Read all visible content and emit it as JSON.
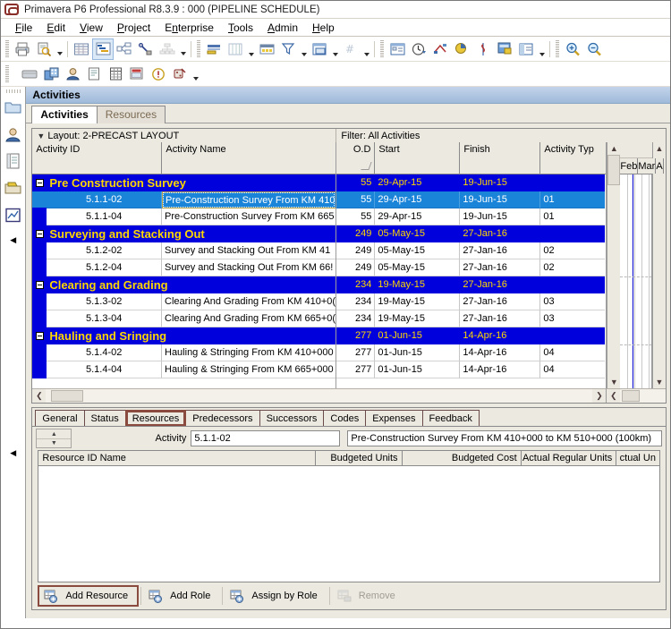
{
  "window": {
    "title": "Primavera P6 Professional R8.3.9 : 000 (PIPELINE SCHEDULE)",
    "logo_icon": "primavera-logo-icon"
  },
  "menubar": {
    "items": [
      {
        "label": "File",
        "accel": "F"
      },
      {
        "label": "Edit",
        "accel": "E"
      },
      {
        "label": "View",
        "accel": "V"
      },
      {
        "label": "Project",
        "accel": "P"
      },
      {
        "label": "Enterprise",
        "accel": "n"
      },
      {
        "label": "Tools",
        "accel": "T"
      },
      {
        "label": "Admin",
        "accel": "A"
      },
      {
        "label": "Help",
        "accel": "H"
      }
    ]
  },
  "toolbar_row1": {
    "buttons": [
      {
        "name": "print-icon"
      },
      {
        "name": "print-preview-icon"
      },
      {
        "name": "caret-down-icon"
      },
      {
        "name": "activity-table-icon"
      },
      {
        "name": "gantt-chart-icon"
      },
      {
        "name": "activity-network-icon"
      },
      {
        "name": "trace-logic-icon"
      },
      {
        "name": "wbs-chart-icon"
      },
      {
        "name": "caret-down-icon"
      },
      {
        "name": "bars-icon"
      },
      {
        "name": "columns-icon"
      },
      {
        "name": "caret-down-icon"
      },
      {
        "name": "timescale-icon"
      },
      {
        "name": "filter-icon"
      },
      {
        "name": "caret-down-icon"
      },
      {
        "name": "group-and-sort-icon"
      },
      {
        "name": "caret-down-icon"
      },
      {
        "name": "page-number-icon"
      },
      {
        "name": "caret-down-icon"
      },
      {
        "name": "activity-details-icon"
      },
      {
        "name": "progress-spotlight-icon"
      },
      {
        "name": "schedule-icon"
      },
      {
        "name": "level-resources-icon"
      },
      {
        "name": "progress-line-icon"
      },
      {
        "name": "store-period-performance-icon"
      },
      {
        "name": "layout-icon"
      },
      {
        "name": "caret-down-icon"
      },
      {
        "name": "zoom-in-icon"
      },
      {
        "name": "zoom-out-icon"
      }
    ]
  },
  "toolbar_row2": {
    "buttons": [
      {
        "name": "projects-icon"
      },
      {
        "name": "wbs-icon"
      },
      {
        "name": "resources-icon"
      },
      {
        "name": "reports-icon"
      },
      {
        "name": "activities-table-icon"
      },
      {
        "name": "assignments-icon"
      },
      {
        "name": "issues-icon"
      },
      {
        "name": "risks-icon"
      },
      {
        "name": "caret-down-icon"
      }
    ]
  },
  "left_rail": {
    "buttons": [
      {
        "name": "projects-rail-icon"
      },
      {
        "name": "resources-rail-icon"
      },
      {
        "name": "reports-rail-icon"
      },
      {
        "name": "wbs-rail-icon"
      },
      {
        "name": "tracking-rail-icon"
      }
    ],
    "collapse_icon": "collapse-left-icon"
  },
  "window_header": {
    "title": "Activities"
  },
  "main_tabs": [
    {
      "label": "Activities",
      "active": true
    },
    {
      "label": "Resources",
      "active": false
    }
  ],
  "activities_panel": {
    "layout_label": "Layout: 2-PRECAST LAYOUT",
    "filter_label": "Filter: All Activities",
    "columns": [
      {
        "key": "id",
        "label": "Activity ID"
      },
      {
        "key": "name",
        "label": "Activity Name"
      },
      {
        "key": "od",
        "label": "O.D",
        "align": "right",
        "sorted": true
      },
      {
        "key": "start",
        "label": "Start"
      },
      {
        "key": "finish",
        "label": "Finish"
      },
      {
        "key": "type",
        "label": "Activity Typ"
      }
    ],
    "rows": [
      {
        "kind": "summary",
        "id": "Pre Construction Survey",
        "name": "",
        "od": "55",
        "start": "29-Apr-15",
        "finish": "19-Jun-15",
        "type": ""
      },
      {
        "kind": "selected",
        "id": "5.1.1-02",
        "name": "Pre-Construction Survey From KM 410",
        "od": "55",
        "start": "29-Apr-15",
        "finish": "19-Jun-15",
        "type": "01"
      },
      {
        "kind": "normal",
        "id": "5.1.1-04",
        "name": "Pre-Construction Survey  From KM 665",
        "od": "55",
        "start": "29-Apr-15",
        "finish": "19-Jun-15",
        "type": "01"
      },
      {
        "kind": "summary",
        "id": "Surveying and Stacking Out",
        "name": "",
        "od": "249",
        "start": "05-May-15",
        "finish": "27-Jan-16",
        "type": ""
      },
      {
        "kind": "normal",
        "id": "5.1.2-02",
        "name": "Survey and Stacking Out  From KM 41",
        "od": "249",
        "start": "05-May-15",
        "finish": "27-Jan-16",
        "type": "02"
      },
      {
        "kind": "normal",
        "id": "5.1.2-04",
        "name": "Survey and Stacking Out From KM 66!",
        "od": "249",
        "start": "05-May-15",
        "finish": "27-Jan-16",
        "type": "02"
      },
      {
        "kind": "summary",
        "id": "Clearing and Grading",
        "name": "",
        "od": "234",
        "start": "19-May-15",
        "finish": "27-Jan-16",
        "type": ""
      },
      {
        "kind": "normal",
        "id": "5.1.3-02",
        "name": "Clearing And Grading From KM 410+0(",
        "od": "234",
        "start": "19-May-15",
        "finish": "27-Jan-16",
        "type": "03"
      },
      {
        "kind": "normal",
        "id": "5.1.3-04",
        "name": "Clearing And Grading From KM 665+0(",
        "od": "234",
        "start": "19-May-15",
        "finish": "27-Jan-16",
        "type": "03"
      },
      {
        "kind": "summary",
        "id": "Hauling and Sringing",
        "name": "",
        "od": "277",
        "start": "01-Jun-15",
        "finish": "14-Apr-16",
        "type": ""
      },
      {
        "kind": "normal",
        "id": "5.1.4-02",
        "name": "Hauling & Stringing From KM 410+000",
        "od": "277",
        "start": "01-Jun-15",
        "finish": "14-Apr-16",
        "type": "04"
      },
      {
        "kind": "normal",
        "id": "5.1.4-04",
        "name": "Hauling & Stringing From KM 665+000",
        "od": "277",
        "start": "01-Jun-15",
        "finish": "14-Apr-16",
        "type": "04"
      }
    ],
    "gantt": {
      "months": [
        "Feb",
        "Mar",
        "A"
      ]
    },
    "scroll": {
      "left_arrow_icon": "scroll-left-icon",
      "right_arrow_icon": "scroll-right-icon",
      "up_arrow_icon": "scroll-up-icon",
      "down_arrow_icon": "scroll-down-icon"
    }
  },
  "details": {
    "tabs": [
      {
        "label": "General",
        "active": false
      },
      {
        "label": "Status",
        "active": false
      },
      {
        "label": "Resources",
        "active": true
      },
      {
        "label": "Predecessors",
        "active": false
      },
      {
        "label": "Successors",
        "active": false
      },
      {
        "label": "Codes",
        "active": false
      },
      {
        "label": "Expenses",
        "active": false
      },
      {
        "label": "Feedback",
        "active": false
      }
    ],
    "activity_label": "Activity",
    "activity_id": "5.1.1-02",
    "activity_name": "Pre-Construction Survey From KM 410+000 to KM 510+000 (100km)",
    "spinner_up_icon": "spinner-up-icon",
    "spinner_down_icon": "spinner-down-icon",
    "resource_columns": [
      {
        "key": "name",
        "label": "Resource ID Name"
      },
      {
        "key": "budgeted_units",
        "label": "Budgeted Units",
        "align": "right"
      },
      {
        "key": "budgeted_cost",
        "label": "Budgeted Cost",
        "align": "right"
      },
      {
        "key": "actual_regular_units",
        "label": "Actual Regular Units",
        "align": "right"
      },
      {
        "key": "actual_units",
        "label": "ctual Un",
        "align": "right"
      }
    ],
    "resource_rows": [],
    "buttons": [
      {
        "label": "Add Resource",
        "icon": "add-resource-icon",
        "state": "highlighted"
      },
      {
        "label": "Add Role",
        "icon": "add-role-icon",
        "state": "normal"
      },
      {
        "label": "Assign by Role",
        "icon": "assign-by-role-icon",
        "state": "normal"
      },
      {
        "label": "Remove",
        "icon": "remove-resource-icon",
        "state": "disabled"
      }
    ]
  },
  "colors": {
    "summary_bg": "#0000dd",
    "summary_fg": "#ffd700",
    "selected_bg": "#1a84d8",
    "selected_fg": "#ffffff",
    "highlight_border": "#8a4a3e",
    "header_band": "#9fbada"
  }
}
